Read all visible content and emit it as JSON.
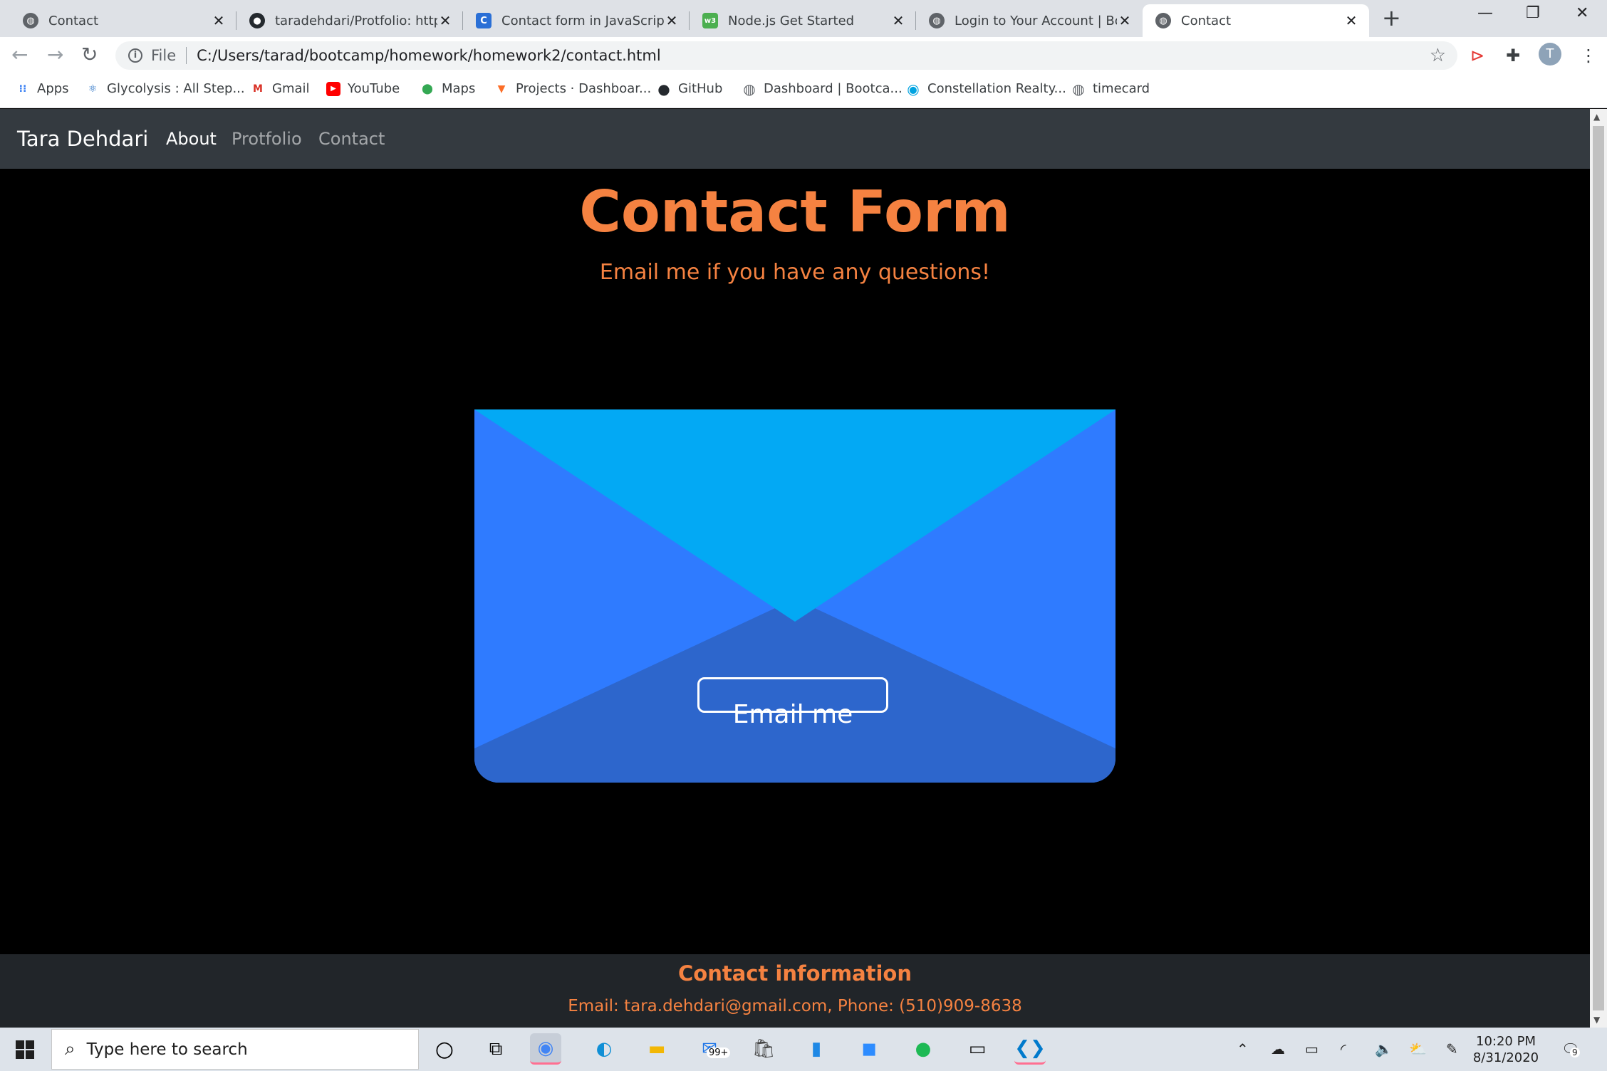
{
  "browser": {
    "tabs": [
      {
        "title": "Contact",
        "favicon": "globe-icon",
        "active": false
      },
      {
        "title": "taradehdari/Protfolio: https:",
        "favicon": "github-icon",
        "active": false
      },
      {
        "title": "Contact form in JavaScript -",
        "favicon": "c-logo-icon",
        "active": false
      },
      {
        "title": "Node.js Get Started",
        "favicon": "w3-icon",
        "active": false
      },
      {
        "title": "Login to Your Account | Boo",
        "favicon": "globe-icon",
        "active": false
      },
      {
        "title": "Contact",
        "favicon": "globe-icon",
        "active": true
      }
    ],
    "new_tab": "+",
    "address": {
      "scheme": "File",
      "url": "C:/Users/tarad/bootcamp/homework/homework2/contact.html"
    },
    "profile_initial": "T",
    "bookmarks": [
      {
        "label": "Apps",
        "icon": "apps-grid-icon"
      },
      {
        "label": "Glycolysis : All Step...",
        "icon": "molecule-icon"
      },
      {
        "label": "Gmail",
        "icon": "gmail-icon"
      },
      {
        "label": "YouTube",
        "icon": "youtube-icon"
      },
      {
        "label": "Maps",
        "icon": "maps-pin-icon"
      },
      {
        "label": "Projects · Dashboar...",
        "icon": "gitlab-icon"
      },
      {
        "label": "GitHub",
        "icon": "github-icon"
      },
      {
        "label": "Dashboard | Bootca...",
        "icon": "globe-icon"
      },
      {
        "label": "Constellation Realty...",
        "icon": "constellation-icon"
      },
      {
        "label": "timecard",
        "icon": "globe-icon"
      }
    ]
  },
  "site": {
    "brand": "Tara Dehdari",
    "nav": [
      {
        "label": "About",
        "active": true
      },
      {
        "label": "Protfolio",
        "active": false
      },
      {
        "label": "Contact",
        "active": false
      }
    ],
    "hero_title": "Contact Form",
    "hero_subtitle": "Email me if you have any questions!",
    "email_button": "Email me",
    "footer_title": "Contact information",
    "footer_info": "Email: tara.dehdari@gmail.com, Phone: (510)909-8638",
    "colors": {
      "accent": "#f58241",
      "nav_bg": "#343a40",
      "footer_bg": "#212529",
      "envelope_flap": "#03a9f4",
      "envelope_side": "#2f7bff",
      "envelope_bottom": "#2d66cc"
    }
  },
  "taskbar": {
    "search_placeholder": "Type here to search",
    "mail_badge": "99+",
    "notification_count": "9",
    "time": "10:20 PM",
    "date": "8/31/2020"
  }
}
